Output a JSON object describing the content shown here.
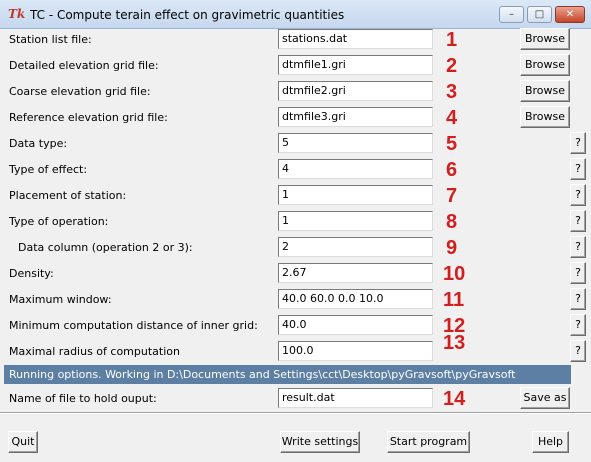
{
  "window": {
    "title_icon": "Tk",
    "title": "TC - Compute terain effect on gravimetric quantities",
    "minimize_symbol": "–",
    "maximize_symbol": "□",
    "close_symbol": "✕"
  },
  "fields": [
    {
      "label": "Station list file:",
      "value": "stations.dat",
      "marker": "1",
      "button": "Browse"
    },
    {
      "label": "Detailed elevation grid file:",
      "value": "dtmfile1.gri",
      "marker": "2",
      "button": "Browse"
    },
    {
      "label": "Coarse elevation grid file:",
      "value": "dtmfile2.gri",
      "marker": "3",
      "button": "Browse"
    },
    {
      "label": "Reference elevation grid file:",
      "value": "dtmfile3.gri",
      "marker": "4",
      "button": "Browse"
    },
    {
      "label": "Data type:",
      "value": "5",
      "marker": "5",
      "button": "?"
    },
    {
      "label": "Type of effect:",
      "value": "4",
      "marker": "6",
      "button": "?"
    },
    {
      "label": "Placement of station:",
      "value": "1",
      "marker": "7",
      "button": "?"
    },
    {
      "label": "Type of operation:",
      "value": "1",
      "marker": "8",
      "button": "?"
    },
    {
      "label": "Data column (operation 2 or 3):",
      "value": "2",
      "marker": "9",
      "button": "?"
    },
    {
      "label": "Density:",
      "value": "2.67",
      "marker": "10",
      "button": "?"
    },
    {
      "label": "Maximum window:",
      "value": "40.0 60.0 0.0 10.0",
      "marker": "11",
      "button": "?"
    },
    {
      "label": "Minimum computation distance of inner grid:",
      "value": "40.0",
      "marker": "12",
      "button": "?"
    },
    {
      "label": "Maximal radius of computation",
      "value": "100.0",
      "marker": "13",
      "button": "?"
    }
  ],
  "running_options": "Running options. Working in D:\\Documents and Settings\\cct\\Desktop\\pyGravsoft\\pyGravsoft",
  "output": {
    "label": "Name of file to hold ouput:",
    "value": "result.dat",
    "marker": "14",
    "button": "Save as"
  },
  "footer": {
    "quit": "Quit",
    "write_settings": "Write settings",
    "start_program": "Start program",
    "help": "Help"
  }
}
